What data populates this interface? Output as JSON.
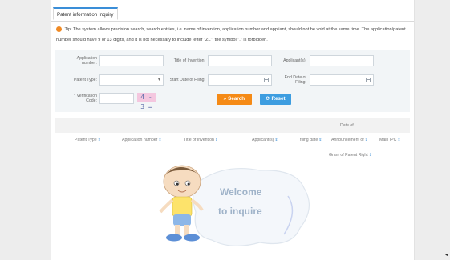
{
  "tab": {
    "label": "Patent information Inquiry"
  },
  "tip": {
    "icon": "info-icon",
    "text": "Tip: The system allows precision search, search entries, i.e. name of invention, application number and appliant, should not be void at the same time. The application/patent number should have 9 or 13 digits, and it is not necessary to include letter \"ZL\", the symbol \".\" is forbidden."
  },
  "form": {
    "application_number_label_1": "Application",
    "application_number_label_2": "number:",
    "title_label": "Title of Invention:",
    "applicant_label": "Applicant(s):",
    "patent_type_label": "Patent Type:",
    "start_date_label": "Start Date of Filing:",
    "end_date_label_1": "End Date of",
    "end_date_label_2": "Filing:",
    "verification_label_1": "* Verification",
    "verification_label_2": "Code:",
    "captcha_text": "4 - 3 ="
  },
  "buttons": {
    "search": "Search",
    "reset": "Reset"
  },
  "table": {
    "header_date_of": "Date of",
    "columns": [
      "Patent Type",
      "Application number",
      "Title of Invention",
      "Applicant(s)",
      "filing date",
      "Announcement of",
      "Main IPC"
    ],
    "grant_column": "Grant of Patent Right"
  },
  "welcome": {
    "line1": "Welcome",
    "line2": "to inquire"
  },
  "colors": {
    "search": "#f58a16",
    "reset": "#3d9de0",
    "tab_accent": "#3a8ed8",
    "welcome_text": "#9fb3c9"
  }
}
